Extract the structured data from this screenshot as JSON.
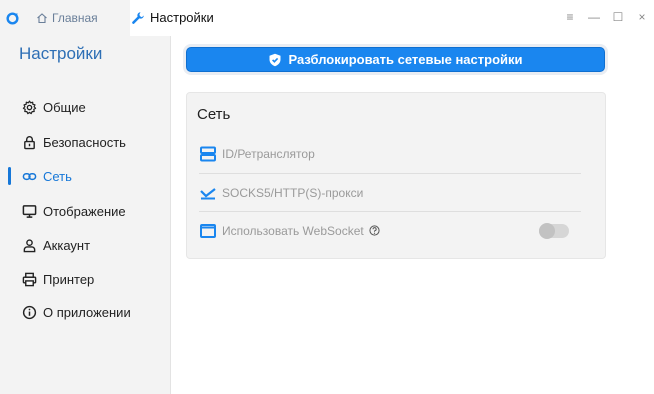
{
  "titlebar": {
    "home_tab_label": "Главная",
    "settings_tab_label": "Настройки",
    "controls": {
      "menu": "≡",
      "minimize": "—",
      "maximize": "☐",
      "close": "×"
    }
  },
  "sidebar": {
    "title": "Настройки",
    "items": [
      {
        "label": "Общие",
        "icon": "gear-icon"
      },
      {
        "label": "Безопасность",
        "icon": "lock-icon"
      },
      {
        "label": "Сеть",
        "icon": "link-icon",
        "active": true
      },
      {
        "label": "Отображение",
        "icon": "monitor-icon"
      },
      {
        "label": "Аккаунт",
        "icon": "user-icon"
      },
      {
        "label": "Принтер",
        "icon": "printer-icon"
      },
      {
        "label": "О приложении",
        "icon": "info-icon"
      }
    ]
  },
  "main": {
    "unlock_button_label": "Разблокировать сетевые настройки",
    "network_card": {
      "title": "Сеть",
      "rows": [
        {
          "label": "ID/Ретранслятор",
          "icon": "server-icon"
        },
        {
          "label": "SOCKS5/HTTP(S)-прокси",
          "icon": "proxy-icon"
        },
        {
          "label": "Использовать WebSocket",
          "icon": "window-icon",
          "toggle": false
        }
      ]
    }
  },
  "colors": {
    "accent": "#1677d8",
    "button": "#1a86ef",
    "sidebar_bg": "#f3f3f3"
  }
}
